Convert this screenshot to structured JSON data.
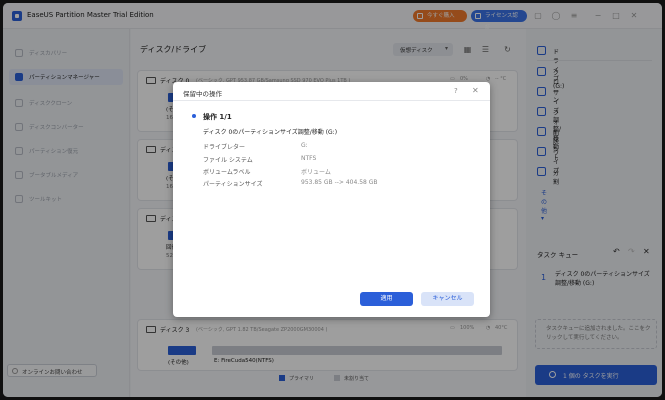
{
  "app": {
    "title": "EaseUS Partition Master Trial Edition"
  },
  "titlebar": {
    "buy_label": "今すぐ購入",
    "license_label": "ライセンス認証"
  },
  "sidebar": {
    "items": [
      {
        "label": "ディスカバリー"
      },
      {
        "label": "パーティションマネージャー"
      },
      {
        "label": "ディスククローン"
      },
      {
        "label": "ディスクコンバーター"
      },
      {
        "label": "パーティション復元"
      },
      {
        "label": "ブータブルメディア"
      },
      {
        "label": "ツールキット"
      }
    ],
    "help_label": "オンラインお問い合わせ"
  },
  "main": {
    "title": "ディスク/ドライブ",
    "view_selector": "仮想ディスク",
    "disks": [
      {
        "name": "ディスク 0",
        "info": "(ベーシック, GPT 953.87 GB/Samsung SSD 970 EVO Plus 1TB )",
        "usage": "0%",
        "temp": "-- °C",
        "part_labels": [
          "(その他)",
          "16.00 MB"
        ]
      },
      {
        "name": "ディスク 1",
        "part_labels": [
          "(その他)",
          "16.00 MB"
        ]
      },
      {
        "name": "ディスク 2",
        "part_labels": [
          "回復",
          "529"
        ]
      },
      {
        "name": "ディスク 3",
        "info": "(ベーシック, GPT 1.82 TB/Seagate ZP2000GM30004 )",
        "usage": "100%",
        "temp": "40°C",
        "part_labels": [
          "(その他)",
          "E: FireCuda540(NTFS)"
        ]
      }
    ],
    "legend": {
      "primary": "プライマリ",
      "unallocated": "未割り当て"
    }
  },
  "right_panel": {
    "drive_label": "ドライブ (G:)",
    "actions": [
      {
        "label": "クローン"
      },
      {
        "label": "サイズ調整/移動"
      },
      {
        "label": "フォーマット"
      },
      {
        "label": "削除"
      },
      {
        "label": "ワイプ"
      },
      {
        "label": "分割"
      }
    ],
    "more_label": "その他 ▾",
    "task_queue": {
      "title": "タスク キュー",
      "item_number": "1",
      "item_text": "ディスク 0のパーティションサイズ調整/移動 (G:)",
      "note": "タスクキューに追加されました。ここをクリックして実行してください。",
      "execute_label": "1 個の タスクを実行"
    }
  },
  "dialog": {
    "title": "保留中の操作",
    "operation_title": "操作 1/1",
    "operation_desc": "ディスク 0のパーティションサイズ調整/移動 (G:)",
    "details": [
      {
        "key": "ドライブレター",
        "value": "G:"
      },
      {
        "key": "ファイル システム",
        "value": "NTFS"
      },
      {
        "key": "ボリュームラベル",
        "value": "ボリューム"
      },
      {
        "key": "パーティションサイズ",
        "value": "953.85 GB --> 404.58 GB"
      }
    ],
    "ok_label": "適用",
    "cancel_label": "キャンセル"
  },
  "colors": {
    "accent": "#2b5fd9",
    "buy": "#f07a2c",
    "partition_fill": "#2b5fd9",
    "unallocated": "#c9ccd3"
  }
}
